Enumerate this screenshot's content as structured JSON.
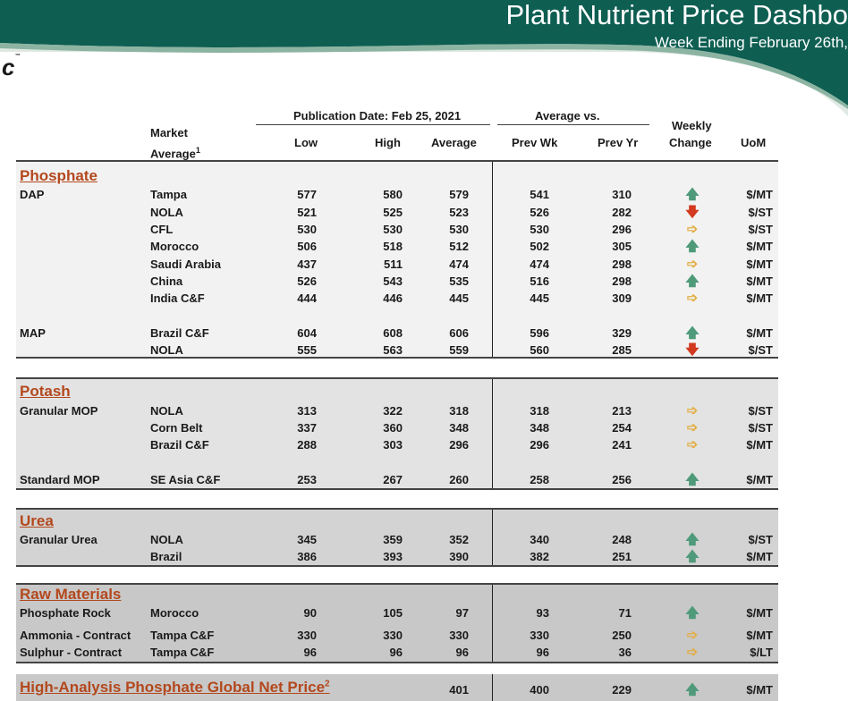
{
  "header": {
    "title": "Plant Nutrient Price Dashbo",
    "subtitle": "Week Ending February 26th,",
    "logo_text": "c",
    "logo_tm": "™"
  },
  "columns": {
    "publication": "Publication Date:  Feb 25, 2021",
    "average_vs": "Average  vs.",
    "market": "Market",
    "average": "Average",
    "market_sup": "1",
    "low": "Low",
    "high": "High",
    "avg": "Average",
    "prev_wk": "Prev Wk",
    "prev_yr": "Prev Yr",
    "weekly": "Weekly",
    "change": "Change",
    "uom": "UoM"
  },
  "sections": {
    "phosphate": "Phosphate",
    "potash": "Potash",
    "urea": "Urea",
    "raw": "Raw Materials",
    "global_net": "High-Analysis Phosphate Global Net Price",
    "global_net_sup": "2"
  },
  "rows": [
    {
      "product": "DAP",
      "market": "Tampa",
      "low": "577",
      "high": "580",
      "avg": "579",
      "prev_wk": "541",
      "prev_yr": "310",
      "change": "up",
      "uom": "$/MT"
    },
    {
      "product": "",
      "market": "NOLA",
      "low": "521",
      "high": "525",
      "avg": "523",
      "prev_wk": "526",
      "prev_yr": "282",
      "change": "down",
      "uom": "$/ST"
    },
    {
      "product": "",
      "market": "CFL",
      "low": "530",
      "high": "530",
      "avg": "530",
      "prev_wk": "530",
      "prev_yr": "296",
      "change": "flat",
      "uom": "$/ST"
    },
    {
      "product": "",
      "market": "Morocco",
      "low": "506",
      "high": "518",
      "avg": "512",
      "prev_wk": "502",
      "prev_yr": "305",
      "change": "up",
      "uom": "$/MT"
    },
    {
      "product": "",
      "market": "Saudi Arabia",
      "low": "437",
      "high": "511",
      "avg": "474",
      "prev_wk": "474",
      "prev_yr": "298",
      "change": "flat",
      "uom": "$/MT"
    },
    {
      "product": "",
      "market": "China",
      "low": "526",
      "high": "543",
      "avg": "535",
      "prev_wk": "516",
      "prev_yr": "298",
      "change": "up",
      "uom": "$/MT"
    },
    {
      "product": "",
      "market": "India C&F",
      "low": "444",
      "high": "446",
      "avg": "445",
      "prev_wk": "445",
      "prev_yr": "309",
      "change": "flat",
      "uom": "$/MT"
    },
    {
      "product": "MAP",
      "market": "Brazil C&F",
      "low": "604",
      "high": "608",
      "avg": "606",
      "prev_wk": "596",
      "prev_yr": "329",
      "change": "up",
      "uom": "$/MT"
    },
    {
      "product": "",
      "market": "NOLA",
      "low": "555",
      "high": "563",
      "avg": "559",
      "prev_wk": "560",
      "prev_yr": "285",
      "change": "down",
      "uom": "$/ST"
    },
    {
      "product": "Granular MOP",
      "market": "NOLA",
      "low": "313",
      "high": "322",
      "avg": "318",
      "prev_wk": "318",
      "prev_yr": "213",
      "change": "flat",
      "uom": "$/ST"
    },
    {
      "product": "",
      "market": "Corn Belt",
      "low": "337",
      "high": "360",
      "avg": "348",
      "prev_wk": "348",
      "prev_yr": "254",
      "change": "flat",
      "uom": "$/ST"
    },
    {
      "product": "",
      "market": "Brazil C&F",
      "low": "288",
      "high": "303",
      "avg": "296",
      "prev_wk": "296",
      "prev_yr": "241",
      "change": "flat",
      "uom": "$/MT"
    },
    {
      "product": "Standard MOP",
      "market": "SE Asia C&F",
      "low": "253",
      "high": "267",
      "avg": "260",
      "prev_wk": "258",
      "prev_yr": "256",
      "change": "up",
      "uom": "$/MT"
    },
    {
      "product": "Granular Urea",
      "market": "NOLA",
      "low": "345",
      "high": "359",
      "avg": "352",
      "prev_wk": "340",
      "prev_yr": "248",
      "change": "up",
      "uom": "$/ST"
    },
    {
      "product": "",
      "market": "Brazil",
      "low": "386",
      "high": "393",
      "avg": "390",
      "prev_wk": "382",
      "prev_yr": "251",
      "change": "up",
      "uom": "$/MT"
    },
    {
      "product": "Phosphate Rock",
      "market": "Morocco",
      "low": "90",
      "high": "105",
      "avg": "97",
      "prev_wk": "93",
      "prev_yr": "71",
      "change": "up",
      "uom": "$/MT"
    },
    {
      "product": "Ammonia - Contract",
      "market": "Tampa C&F",
      "low": "330",
      "high": "330",
      "avg": "330",
      "prev_wk": "330",
      "prev_yr": "250",
      "change": "flat",
      "uom": "$/MT"
    },
    {
      "product": "Sulphur - Contract",
      "market": "Tampa C&F",
      "low": "96",
      "high": "96",
      "avg": "96",
      "prev_wk": "96",
      "prev_yr": "36",
      "change": "flat",
      "uom": "$/LT"
    },
    {
      "product": "",
      "market": "",
      "low": "",
      "high": "",
      "avg": "401",
      "prev_wk": "400",
      "prev_yr": "229",
      "change": "up",
      "uom": "$/MT"
    }
  ],
  "change_glyphs": {
    "up": "🡅",
    "down": "🡇",
    "flat": "➩"
  },
  "colors": {
    "banner_teal": "#0e5e52",
    "section_title": "#b3481d",
    "arrow_up": "#4f9a79",
    "arrow_down": "#d2391e",
    "arrow_flat": "#e3ae45",
    "band_light": "#f2f2f2",
    "band_mid": "#e3e3e3",
    "band_dark": "#d3d3d3",
    "band_darker": "#c8c8c8"
  }
}
